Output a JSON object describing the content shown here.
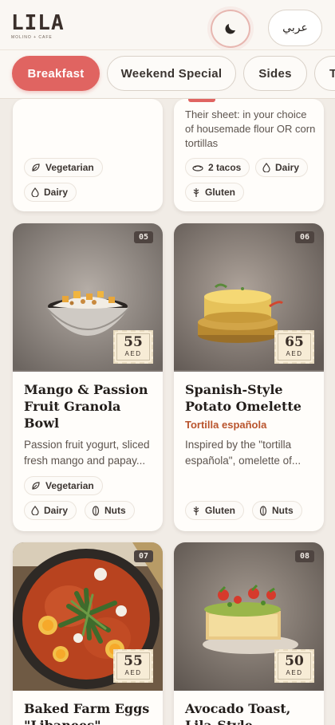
{
  "header": {
    "logo_text": "LILA",
    "logo_subtitle": "MOLINO + CAFE",
    "theme_icon": "moon-icon",
    "language_label": "عربي"
  },
  "tabs": [
    {
      "label": "Breakfast",
      "active": true
    },
    {
      "label": "Weekend Special",
      "active": false
    },
    {
      "label": "Sides",
      "active": false
    },
    {
      "label": "T",
      "active": false
    }
  ],
  "items": [
    {
      "number": "",
      "title": "",
      "subtitle": "",
      "description": "",
      "price": "",
      "currency": "",
      "tags": [
        {
          "icon": "leaf-icon",
          "label": "Vegetarian"
        },
        {
          "icon": "drop-icon",
          "label": "Dairy"
        }
      ]
    },
    {
      "number": "",
      "title": "",
      "subtitle": "",
      "description": "Their sheet: in your choice of housemade flour OR corn tortillas",
      "price": "",
      "currency": "",
      "tags": [
        {
          "icon": "plate-icon",
          "label": "2 tacos"
        },
        {
          "icon": "drop-icon",
          "label": "Dairy"
        },
        {
          "icon": "wheat-icon",
          "label": "Gluten"
        }
      ]
    },
    {
      "number": "05",
      "title": "Mango & Passion Fruit Granola Bowl",
      "subtitle": "",
      "description": "Passion fruit yogurt, sliced fresh mango and papay...",
      "price": "55",
      "currency": "AED",
      "tags": [
        {
          "icon": "leaf-icon",
          "label": "Vegetarian"
        },
        {
          "icon": "drop-icon",
          "label": "Dairy"
        },
        {
          "icon": "nut-icon",
          "label": "Nuts"
        }
      ]
    },
    {
      "number": "06",
      "title": "Spanish-Style Potato Omelette",
      "subtitle": "Tortilla española",
      "description": "Inspired by the \"tortilla española\", omelette of...",
      "price": "65",
      "currency": "AED",
      "tags": [
        {
          "icon": "wheat-icon",
          "label": "Gluten"
        },
        {
          "icon": "nut-icon",
          "label": "Nuts"
        }
      ]
    },
    {
      "number": "07",
      "title": "Baked Farm Eggs \"Libanees\"",
      "subtitle": "",
      "description": "",
      "price": "55",
      "currency": "AED",
      "tags": []
    },
    {
      "number": "08",
      "title": "Avocado Toast, Lila-Style",
      "subtitle": "",
      "description": "",
      "price": "50",
      "currency": "AED",
      "tags": []
    }
  ]
}
